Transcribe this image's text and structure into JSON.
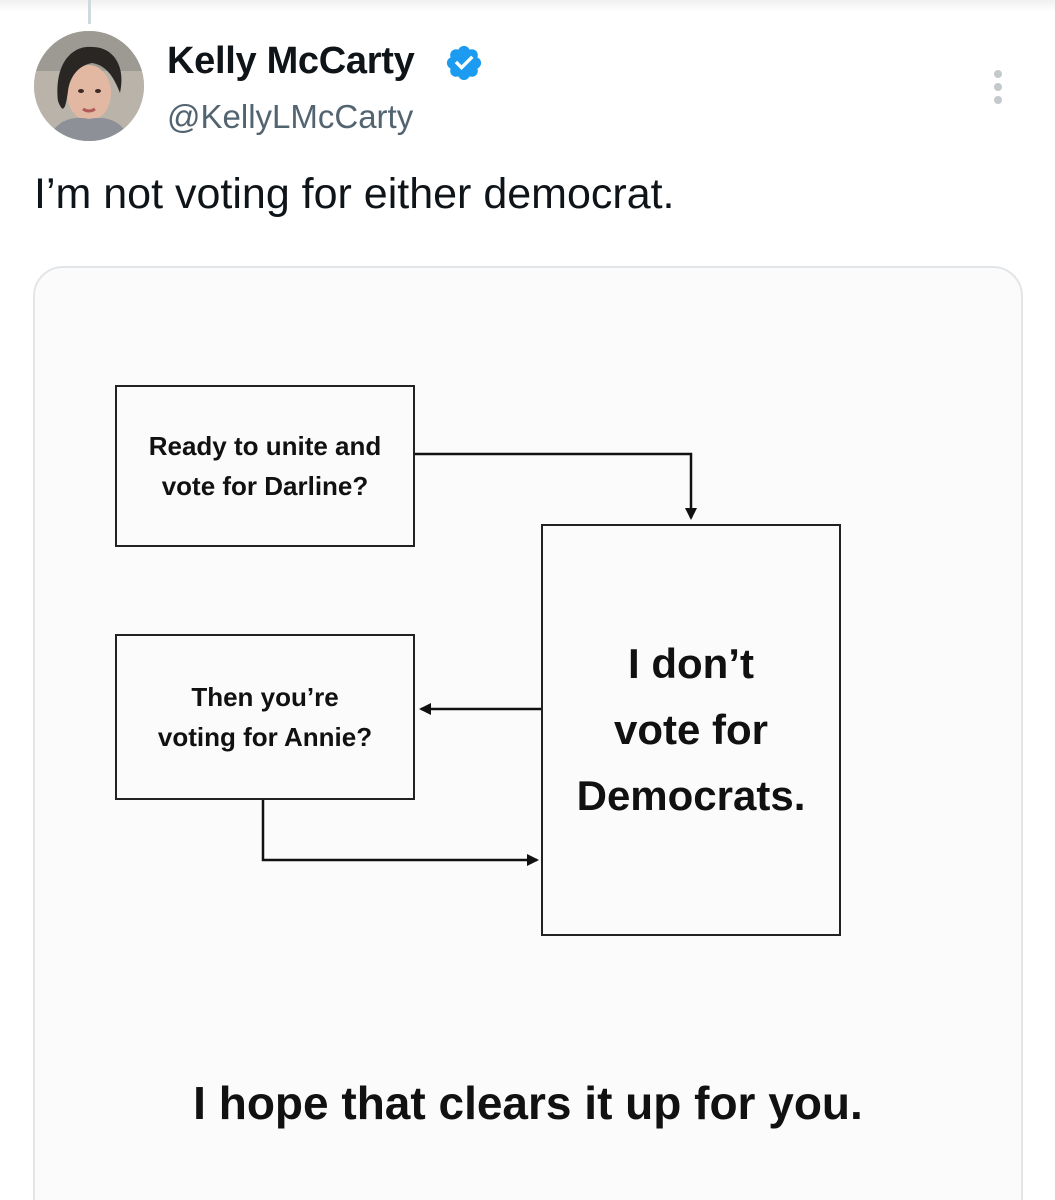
{
  "author": {
    "name": "Kelly McCarty",
    "handle": "@KellyLMcCarty",
    "verified": true,
    "verified_color": "#1d9bf0"
  },
  "tweet": {
    "text": "I’m not voting for either democrat."
  },
  "icons": {
    "verified": "verified-badge-icon",
    "more": "more-options-icon"
  },
  "flowchart": {
    "box_darline": {
      "line1": "Ready to unite and",
      "line2": "vote for Darline?"
    },
    "box_annie": {
      "line1": "Then you’re",
      "line2": "voting for Annie?"
    },
    "box_democrats": {
      "line1": "I don’t",
      "line2": "vote for",
      "line3": "Democrats."
    },
    "caption": "I hope that clears it up for you."
  },
  "colors": {
    "text_primary": "#0f1419",
    "text_secondary": "#536471",
    "card_border": "#e3e6e8"
  }
}
